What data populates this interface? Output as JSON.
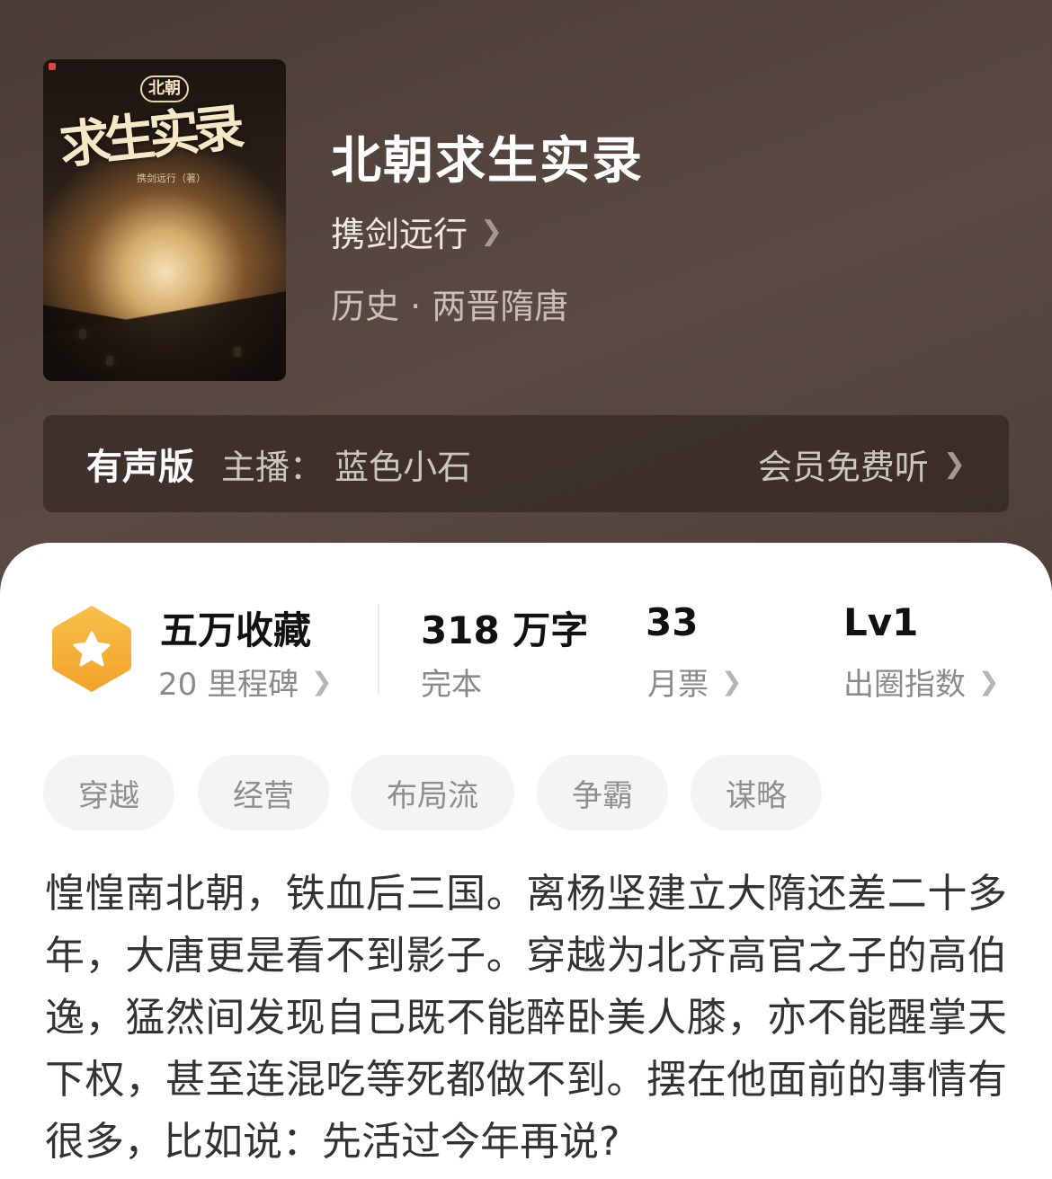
{
  "book": {
    "cover": {
      "series": "北朝",
      "title": "求生实录",
      "author_small": "携剑远行（著）"
    },
    "title": "北朝求生实录",
    "author": "携剑远行",
    "genre": "历史 · 两晋隋唐"
  },
  "audio": {
    "label": "有声版",
    "host": "主播：  蓝色小石",
    "cta": "会员免费听"
  },
  "stats": {
    "collections": "五万收藏",
    "milestones": "20 里程碑",
    "word_count": "318 万字",
    "status": "完本",
    "monthly_tickets": "33",
    "monthly_tickets_label": "月票",
    "level": "Lv1",
    "level_label": "出圈指数"
  },
  "tags": [
    "穿越",
    "经营",
    "布局流",
    "争霸",
    "谋略"
  ],
  "synopsis": "惶惶南北朝，铁血后三国。离杨坚建立大隋还差二十多年，大唐更是看不到影子。穿越为北齐高官之子的高伯逸，猛然间发现自己既不能醉卧美人膝，亦不能醒掌天下权，甚至连混吃等死都做不到。摆在他面前的事情有很多，比如说：先活过今年再说?",
  "colors": {
    "header_bg": "#4f413a",
    "badge_orange": "#f5b234",
    "tag_bg": "#f4f4f4",
    "text_dark": "#111111",
    "text_gray": "#8a8a8a"
  },
  "icons": {
    "chevron": "chevron-right-icon",
    "badge": "star-hexagon-icon"
  }
}
